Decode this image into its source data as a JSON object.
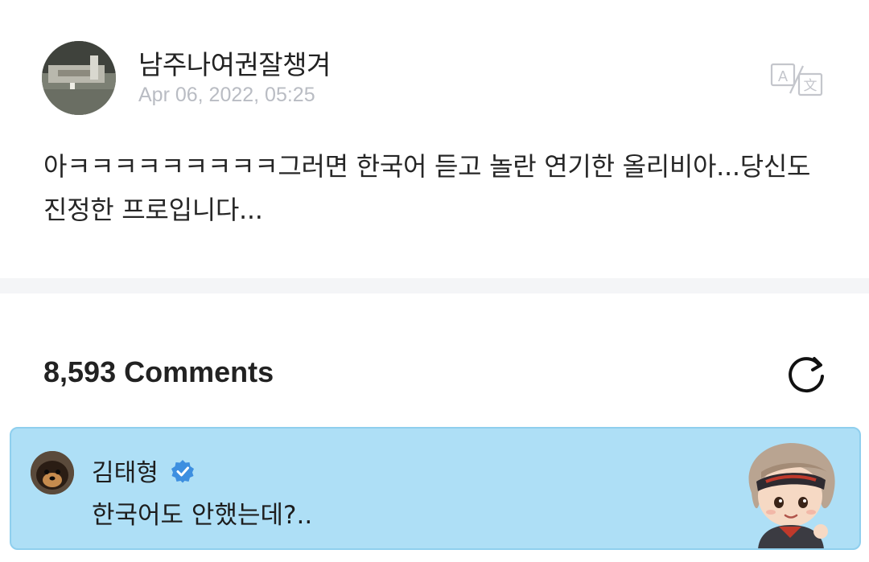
{
  "post": {
    "author": "남주나여권잘챙겨",
    "timestamp": "Apr 06, 2022, 05:25",
    "translate_icon": "translate-icon",
    "content": "아ㅋㅋㅋㅋㅋㅋㅋㅋㅋ그러면 한국어 듣고 놀란 연기한 올리비아...당신도 진정한 프로입니다..."
  },
  "comments": {
    "count_label": "8,593 Comments",
    "refresh_icon": "refresh-icon",
    "items": [
      {
        "author": "김태형",
        "verified": true,
        "text": "한국어도 안했는데?..",
        "background": "#aedff6"
      }
    ]
  },
  "colors": {
    "timestamp": "#b9bcc3",
    "divider": "#f4f5f7",
    "verified_badge": "#3d8fe0",
    "comment_bg": "#aedff6"
  }
}
